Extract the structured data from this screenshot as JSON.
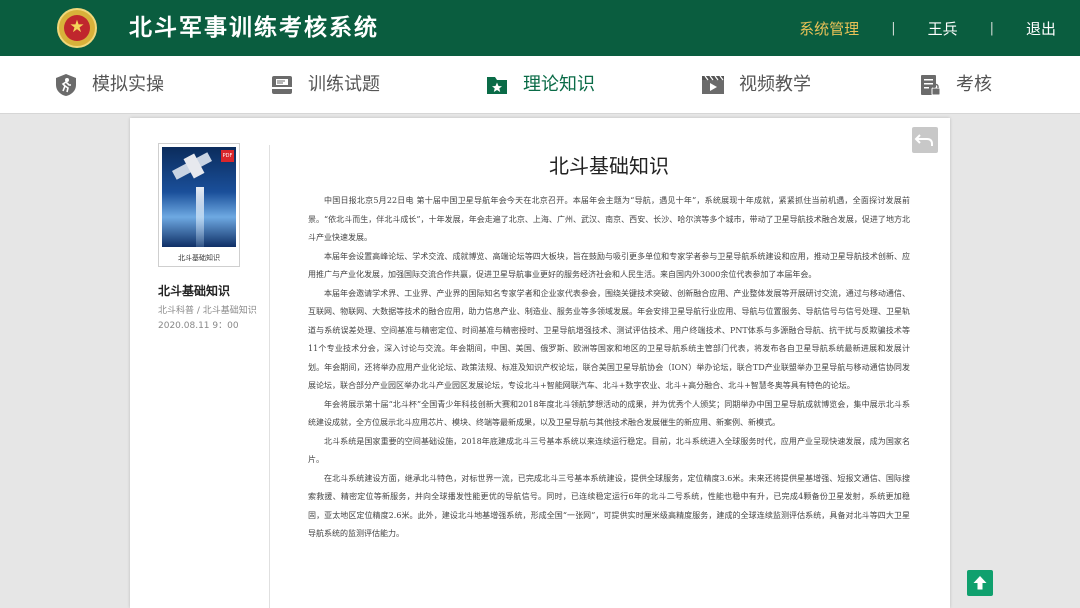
{
  "header": {
    "title": "北斗军事训练考核系统",
    "admin_label": "系统管理",
    "user_name": "王兵",
    "logout_label": "退出"
  },
  "nav": {
    "items": [
      {
        "label": "模拟实操",
        "icon": "runner-shield-icon"
      },
      {
        "label": "训练试题",
        "icon": "tray-document-icon"
      },
      {
        "label": "理论知识",
        "icon": "folder-star-icon"
      },
      {
        "label": "视频教学",
        "icon": "film-play-icon"
      },
      {
        "label": "考核",
        "icon": "checklist-lock-icon"
      }
    ],
    "active_index": 2
  },
  "sidebar": {
    "thumb_caption": "北斗基础知识",
    "title": "北斗基础知识",
    "meta": "北斗科普 / 北斗基础知识",
    "date": "2020.08.11  9：00"
  },
  "article": {
    "title": "北斗基础知识",
    "paragraphs": [
      "中国日报北京5月22日电  第十届中国卫星导航年会今天在北京召开。本届年会主题为“导航，遇见十年”，系统展现十年成就，紧紧抓住当前机遇，全面探讨发展前景。“依北斗而生，伴北斗成长”，十年发展，年会走遍了北京、上海、广州、武汉、南京、西安、长沙、哈尔滨等多个城市，带动了卫星导航技术融合发展，促进了地方北斗产业快速发展。",
      "本届年会设置高峰论坛、学术交流、成就博览、高端论坛等四大板块，旨在鼓励与吸引更多单位和专家学者参与卫星导航系统建设和应用，推动卫星导航技术创新、应用推广与产业化发展，加强国际交流合作共赢，促进卫星导航事业更好的服务经济社会和人民生活。来自国内外3000余位代表参加了本届年会。",
      "本届年会邀请学术界、工业界、产业界的国际知名专家学者和企业家代表参会，围绕关键技术突破、创新融合应用、产业整体发展等开展研讨交流，通过与移动通信、互联网、物联网、大数据等技术的融合应用，助力信息产业、制造业、服务业等多领域发展。年会安排卫星导航行业应用、导航与位置服务、导航信号与信号处理、卫星轨道与系统误差处理、空间基准与精密定位、时间基准与精密授时、卫星导航增强技术、测试评估技术、用户终端技术、PNT体系与多源融合导航、抗干扰与反欺骗技术等11个专业技术分会，深入讨论与交流。年会期间，中国、美国、俄罗斯、欧洲等国家和地区的卫星导航系统主管部门代表，将发布各自卫星导航系统最新进展和发展计划。年会期间，还将举办应用产业化论坛、政策法规、标准及知识产权论坛，联合美国卫星导航协会（ION）举办论坛，联合TD产业联盟举办卫星导航与移动通信协同发展论坛，联合部分产业园区举办北斗产业园区发展论坛，专设北斗+智能网联汽车、北斗+数字农业、北斗+高分融合、北斗+智慧冬奥等具有特色的论坛。",
      "年会将展示第十届“北斗杯”全国青少年科技创新大赛和2018年度北斗领航梦想活动的成果，并为优秀个人颁奖；同期举办中国卫星导航成就博览会，集中展示北斗系统建设成就，全方位展示北斗应用芯片、模块、终端等最新成果，以及卫星导航与其他技术融合发展催生的新应用、新案例、新模式。",
      "北斗系统是国家重要的空间基础设施，2018年底建成北斗三号基本系统以来连续运行稳定。目前，北斗系统进入全球服务时代，应用产业呈现快速发展，成为国家名片。",
      "在北斗系统建设方面，继承北斗特色，对标世界一流，已完成北斗三号基本系统建设，提供全球服务，定位精度3.6米。未来还将提供星基增强、短报文通信、国际搜索救援、精密定位等新服务，并向全球播发性能更优的导航信号。同时，已连续稳定运行6年的北斗二号系统，性能也稳中有升，已完成4颗备份卫星发射，系统更加稳固，亚太地区定位精度2.6米。此外，建设北斗地基增强系统，形成全国“一张网”，可提供实时厘米级高精度服务，建成的全球连续监测评估系统，具备对北斗等四大卫星导航系统的监测评估能力。"
    ]
  },
  "colors": {
    "header_bg": "#0a5d3f",
    "accent_gold": "#e8c157",
    "active_nav": "#0a6b47",
    "scroll_top_button": "#10a06e"
  }
}
